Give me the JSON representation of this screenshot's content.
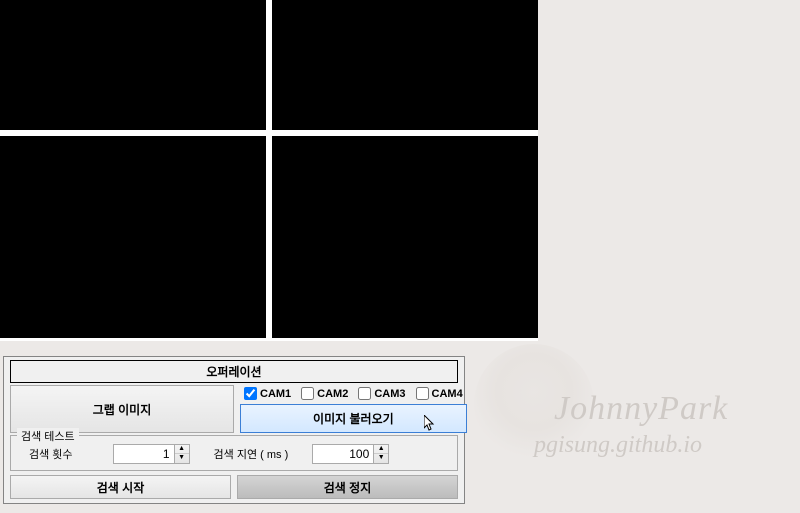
{
  "cameras": [
    "CAM1",
    "CAM2",
    "CAM3",
    "CAM4"
  ],
  "operation": {
    "header": "오퍼레이션",
    "grab_label": "그랩 이미지",
    "cam_checks": [
      {
        "label": "CAM1",
        "checked": true
      },
      {
        "label": "CAM2",
        "checked": false
      },
      {
        "label": "CAM3",
        "checked": false
      },
      {
        "label": "CAM4",
        "checked": false
      }
    ],
    "load_label": "이미지 불러오기"
  },
  "test": {
    "legend": "검색 테스트",
    "count_label": "검색 횟수",
    "count_value": "1",
    "delay_label": "검색 지연 ( ms )",
    "delay_value": "100",
    "start_label": "검색 시작",
    "stop_label": "검색 정지"
  },
  "watermark": {
    "name": "JohnnyPark",
    "url": "pgisung.github.io"
  }
}
